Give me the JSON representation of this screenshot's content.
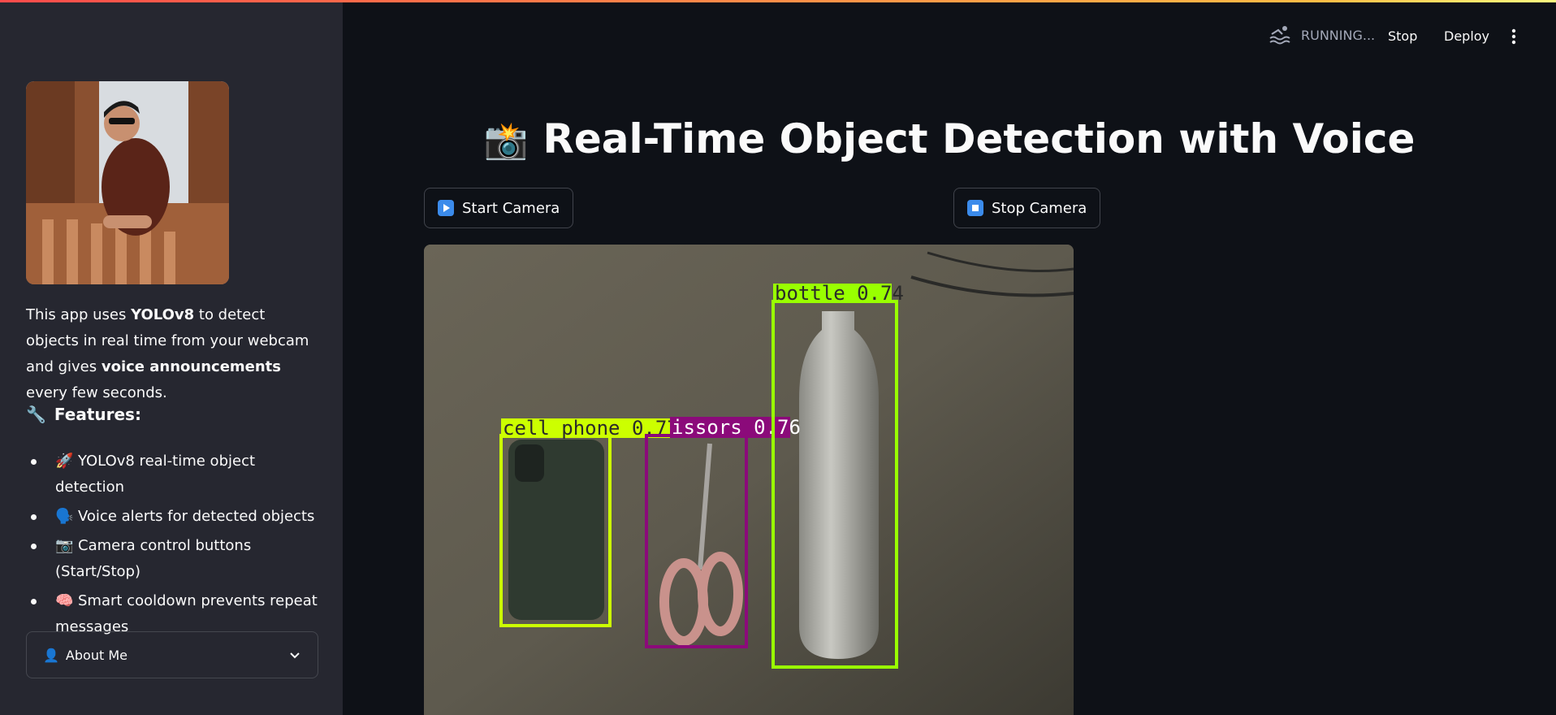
{
  "header": {
    "status": "RUNNING...",
    "stop_label": "Stop",
    "deploy_label": "Deploy",
    "menu_icon": "vertical-dots-icon"
  },
  "sidebar": {
    "intro_part1": "This app uses ",
    "intro_bold1": "YOLOv8",
    "intro_part2": " to detect objects in real time from your webcam and gives ",
    "intro_bold2": "voice announcements",
    "intro_part3": " every few seconds.",
    "features_icon": "🔧",
    "features_heading": "Features:",
    "features": [
      {
        "icon": "🚀",
        "text": "YOLOv8 real-time object detection"
      },
      {
        "icon": "🗣️",
        "text": "Voice alerts for detected objects"
      },
      {
        "icon": "📷",
        "text": "Camera control buttons (Start/Stop)"
      },
      {
        "icon": "🧠",
        "text": "Smart cooldown prevents repeat messages"
      }
    ],
    "about_icon": "👤",
    "about_label": "About Me"
  },
  "main": {
    "title_icon": "📸",
    "title": "Real-Time Object Detection with Voice",
    "start_button": "Start Camera",
    "stop_button": "Stop Camera",
    "detections": [
      {
        "label": "cell phone 0.77",
        "color": "#ccff00"
      },
      {
        "label": "issors 0.76",
        "color": "#8b0a7a"
      },
      {
        "label": "bottle 0.74",
        "color": "#99ff00"
      }
    ]
  }
}
